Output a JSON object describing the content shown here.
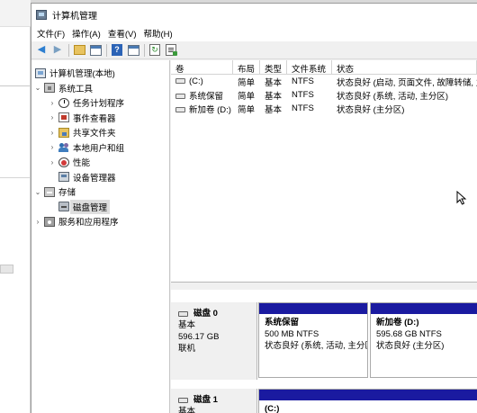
{
  "window": {
    "title": "计算机管理"
  },
  "menu": [
    "文件(F)",
    "操作(A)",
    "查看(V)",
    "帮助(H)"
  ],
  "tree": {
    "root": "计算机管理(本地)",
    "system_tools": "系统工具",
    "task_scheduler": "任务计划程序",
    "event_viewer": "事件查看器",
    "shared_folders": "共享文件夹",
    "local_users": "本地用户和组",
    "performance": "性能",
    "device_manager": "设备管理器",
    "storage": "存储",
    "disk_management": "磁盘管理",
    "services": "服务和应用程序"
  },
  "volume_table": {
    "headers": [
      "卷",
      "布局",
      "类型",
      "文件系统",
      "状态"
    ],
    "rows": [
      {
        "volume": "(C:)",
        "layout": "简单",
        "type": "基本",
        "fs": "NTFS",
        "status": "状态良好 (启动, 页面文件, 故障转储, 主"
      },
      {
        "volume": "系统保留",
        "layout": "简单",
        "type": "基本",
        "fs": "NTFS",
        "status": "状态良好 (系统, 活动, 主分区)"
      },
      {
        "volume": "新加卷 (D:)",
        "layout": "简单",
        "type": "基本",
        "fs": "NTFS",
        "status": "状态良好 (主分区)"
      }
    ]
  },
  "disks": [
    {
      "name": "磁盘 0",
      "type": "基本",
      "size": "596.17 GB",
      "state": "联机",
      "partitions": [
        {
          "name": "系统保留",
          "size": "500 MB NTFS",
          "status": "状态良好 (系统, 活动, 主分区)"
        },
        {
          "name": "新加卷  (D:)",
          "size": "595.68 GB NTFS",
          "status": "状态良好 (主分区)"
        }
      ]
    },
    {
      "name": "磁盘 1",
      "type": "基本",
      "partitions": [
        {
          "name": "(C:)"
        }
      ]
    }
  ],
  "colors": {
    "partition_bar": "#1a1aa0",
    "selection": "#dedede"
  }
}
